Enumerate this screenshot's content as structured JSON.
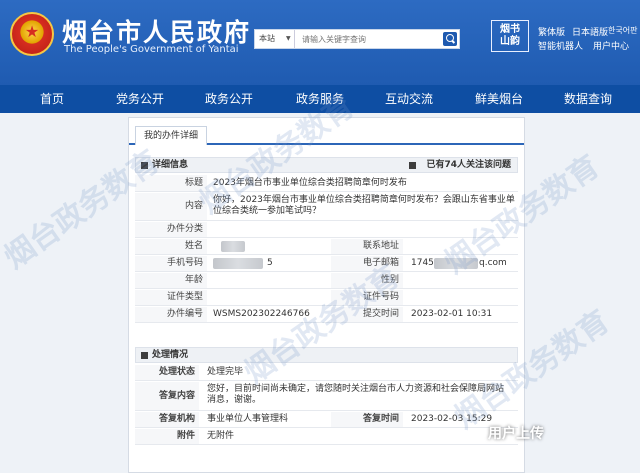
{
  "header": {
    "title": "烟台市人民政府",
    "subtitle": "The People's Government of Yantai",
    "search": {
      "scope": "本站",
      "placeholder": "请输入关键字查询"
    },
    "badge": {
      "line1": "烟书",
      "line2": "山韵"
    },
    "links": [
      "繁体版",
      "日本語版",
      "한국어판",
      "智能机器人",
      "用户中心"
    ]
  },
  "nav": [
    "首页",
    "党务公开",
    "政务公开",
    "政务服务",
    "互动交流",
    "鲜美烟台",
    "数据查询"
  ],
  "card": {
    "tab": "我的办件详细",
    "detail": {
      "heading": "详细信息",
      "watch_count": "已有74人关注该问题",
      "title_label": "标题",
      "title_value": "2023年烟台市事业单位综合类招聘简章何时发布",
      "content_label": "内容",
      "content_value": "你好，2023年烟台市事业单位综合类招聘简章何时发布？会跟山东省事业单位综合类统一参加笔试吗？",
      "category_label": "办件分类",
      "name_label": "姓名",
      "address_label": "联系地址",
      "phone_label": "手机号码",
      "phone_tail": "5",
      "email_label": "电子邮箱",
      "email_head": "1745",
      "email_tail": "q.com",
      "age_label": "年龄",
      "gender_label": "性别",
      "idtype_label": "证件类型",
      "idnum_label": "证件号码",
      "case_label": "办件编号",
      "case_value": "WSMS202302246766",
      "submit_label": "提交时间",
      "submit_value": "2023-02-01 10:31"
    },
    "reply": {
      "heading": "处理情况",
      "status_label": "处理状态",
      "status_value": "处理完毕",
      "content_label": "答复内容",
      "content_value": "您好，目前时间尚未确定，请您随时关注烟台市人力资源和社会保障局网站消息，谢谢。",
      "org_label": "答复机构",
      "org_value": "事业单位人事管理科",
      "time_label": "答复时间",
      "time_value": "2023-02-03 15:29",
      "attach_label": "附件",
      "attach_value": "无附件"
    }
  },
  "watermark": "烟台政务数育",
  "upload_mark": "用户上传"
}
